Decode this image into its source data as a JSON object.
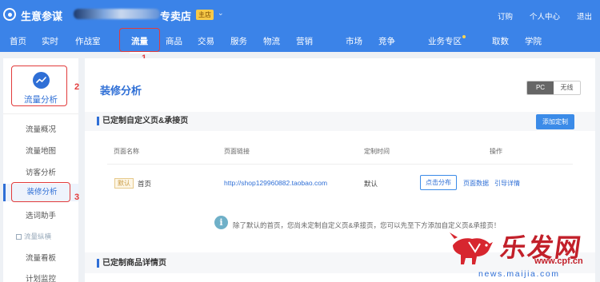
{
  "app": {
    "title": "生意参谋",
    "shop_suffix": "专卖店",
    "shop_badge": "主店"
  },
  "top_links": [
    "订购",
    "个人中心",
    "退出"
  ],
  "nav": {
    "items": [
      "首页",
      "实时",
      "作战室",
      "流量",
      "商品",
      "交易",
      "服务",
      "物流",
      "营销",
      "市场",
      "竞争",
      "业务专区",
      "取数",
      "学院"
    ],
    "active": "流量"
  },
  "annotations": [
    "1",
    "2",
    "3"
  ],
  "sidebar": {
    "title": "流量分析",
    "items": [
      "流量概况",
      "流量地图",
      "访客分析",
      "装修分析",
      "选词助手"
    ],
    "group_label": "流量纵横",
    "items2": [
      "流量看板",
      "计划监控"
    ],
    "active": "装修分析"
  },
  "main": {
    "title": "装修分析",
    "device_toggle": [
      "PC",
      "无线"
    ],
    "device_selected": "PC",
    "section1": {
      "title": "已定制自定义页&承接页",
      "add_button": "添加定制",
      "columns": [
        "页面名称",
        "页面链接",
        "定制时间",
        "操作"
      ],
      "rows": [
        {
          "badge": "默认",
          "name": "首页",
          "link": "http://shop129960882.taobao.com",
          "time": "默认",
          "actions": [
            "点击分布",
            "页面数据",
            "引导详情"
          ]
        }
      ],
      "info": "除了默认的首页，您尚未定制自定义页&承接页，您可以先至下方添加自定义页&承接页！"
    },
    "section2": {
      "title": "已定制商品详情页"
    }
  },
  "watermark": {
    "text": "乐发网",
    "url1": "www.cpf.cn",
    "url2": "news.maijia.com"
  },
  "colors": {
    "brand_blue": "#3b83e8",
    "accent_blue": "#2f6fd6",
    "annotation_red": "#e23b3b"
  }
}
